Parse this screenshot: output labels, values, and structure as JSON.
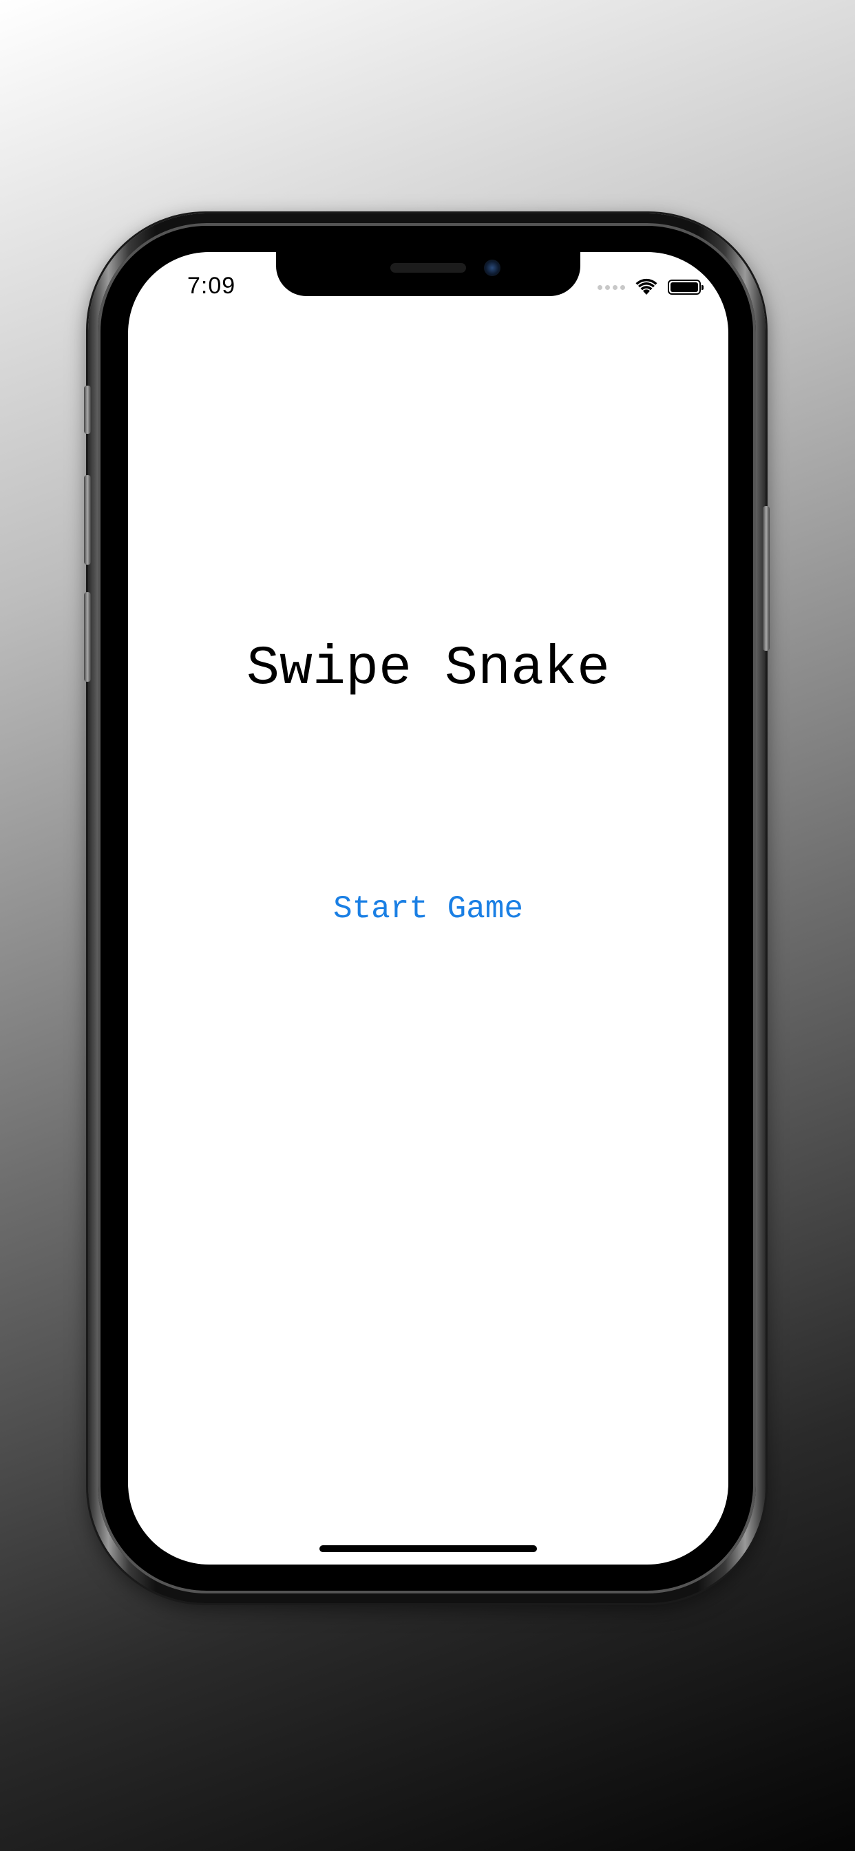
{
  "status_bar": {
    "time": "7:09",
    "signal_icon": "cellular-signal-dots",
    "wifi_icon": "wifi",
    "battery_icon": "battery-full",
    "battery_level": 1.0
  },
  "main": {
    "title": "Swipe Snake",
    "start_label": "Start Game"
  },
  "colors": {
    "button_text": "#1a7fe4",
    "title_text": "#000000",
    "screen_background": "#ffffff"
  }
}
